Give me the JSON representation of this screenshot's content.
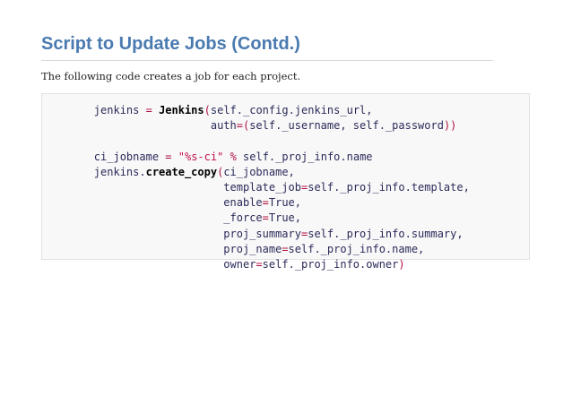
{
  "slide": {
    "title": "Script to Update Jobs (Contd.)",
    "intro": "The following code creates a job for each project."
  },
  "code": {
    "lines": [
      [
        {
          "t": "        jenkins ",
          "c": "k-plain"
        },
        {
          "t": "=",
          "c": "k-op"
        },
        {
          "t": " ",
          "c": "k-plain"
        },
        {
          "t": "Jenkins",
          "c": "k-fn"
        },
        {
          "t": "(",
          "c": "k-op"
        },
        {
          "t": "self._config.jenkins_url,",
          "c": "k-plain"
        }
      ],
      [
        {
          "t": "                          auth",
          "c": "k-plain"
        },
        {
          "t": "=(",
          "c": "k-op"
        },
        {
          "t": "self._username, self._password",
          "c": "k-plain"
        },
        {
          "t": "))",
          "c": "k-op"
        }
      ],
      [],
      [
        {
          "t": "        ci_jobname ",
          "c": "k-plain"
        },
        {
          "t": "=",
          "c": "k-op"
        },
        {
          "t": " ",
          "c": "k-plain"
        },
        {
          "t": "\"%s-ci\"",
          "c": "k-str"
        },
        {
          "t": " ",
          "c": "k-plain"
        },
        {
          "t": "%",
          "c": "k-op"
        },
        {
          "t": " self._proj_info.name",
          "c": "k-plain"
        }
      ],
      [
        {
          "t": "        jenkins.",
          "c": "k-plain"
        },
        {
          "t": "create_copy",
          "c": "k-fn"
        },
        {
          "t": "(",
          "c": "k-op"
        },
        {
          "t": "ci_jobname,",
          "c": "k-plain"
        }
      ],
      [
        {
          "t": "                            template_job",
          "c": "k-plain"
        },
        {
          "t": "=",
          "c": "k-op"
        },
        {
          "t": "self._proj_info.template,",
          "c": "k-plain"
        }
      ],
      [
        {
          "t": "                            enable",
          "c": "k-plain"
        },
        {
          "t": "=",
          "c": "k-op"
        },
        {
          "t": "True,",
          "c": "k-plain"
        }
      ],
      [
        {
          "t": "                            _force",
          "c": "k-plain"
        },
        {
          "t": "=",
          "c": "k-op"
        },
        {
          "t": "True,",
          "c": "k-plain"
        }
      ],
      [
        {
          "t": "                            proj_summary",
          "c": "k-plain"
        },
        {
          "t": "=",
          "c": "k-op"
        },
        {
          "t": "self._proj_info.summary,",
          "c": "k-plain"
        }
      ],
      [
        {
          "t": "                            proj_name",
          "c": "k-plain"
        },
        {
          "t": "=",
          "c": "k-op"
        },
        {
          "t": "self._proj_info.name,",
          "c": "k-plain"
        }
      ],
      [
        {
          "t": "                            owner",
          "c": "k-plain"
        },
        {
          "t": "=",
          "c": "k-op"
        },
        {
          "t": "self._proj_info.owner",
          "c": "k-plain"
        },
        {
          "t": ")",
          "c": "k-op"
        }
      ]
    ]
  },
  "colors": {
    "title": "#4a7ab0",
    "operator": "#b01040",
    "string": "#c01050",
    "identifier": "#2a2a5a",
    "code_background": "#f8f8f8"
  }
}
